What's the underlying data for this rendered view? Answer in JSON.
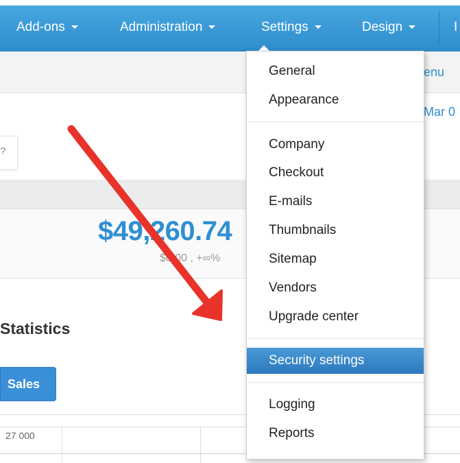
{
  "navbar": {
    "items": [
      {
        "label": "Add-ons"
      },
      {
        "label": "Administration"
      },
      {
        "label": "Settings"
      },
      {
        "label": "Design"
      }
    ],
    "overflow_label": "I"
  },
  "subbar": {
    "menu_link": "enu",
    "date_link": "Mar 0"
  },
  "help": {
    "text": "?"
  },
  "summary": {
    "total": "$49,260.74",
    "change": "$0.00 , +∞%"
  },
  "statistics": {
    "title": "Statistics",
    "sales_button": "Sales"
  },
  "chart": {
    "y_tick": "27 000"
  },
  "settings_menu": {
    "groups": [
      [
        "General",
        "Appearance"
      ],
      [
        "Company",
        "Checkout",
        "E-mails",
        "Thumbnails",
        "Sitemap",
        "Vendors",
        "Upgrade center"
      ],
      [
        "Security settings"
      ],
      [
        "Logging",
        "Reports"
      ]
    ],
    "items": {
      "general": "General",
      "appearance": "Appearance",
      "company": "Company",
      "checkout": "Checkout",
      "emails": "E-mails",
      "thumbnails": "Thumbnails",
      "sitemap": "Sitemap",
      "vendors": "Vendors",
      "upgrade_center": "Upgrade center",
      "security_settings": "Security settings",
      "logging": "Logging",
      "reports": "Reports"
    },
    "active_item": "Security settings"
  },
  "colors": {
    "navbar": "#3a9bd9",
    "accent": "#2f8fd2",
    "annotation_arrow": "#e8332a"
  }
}
